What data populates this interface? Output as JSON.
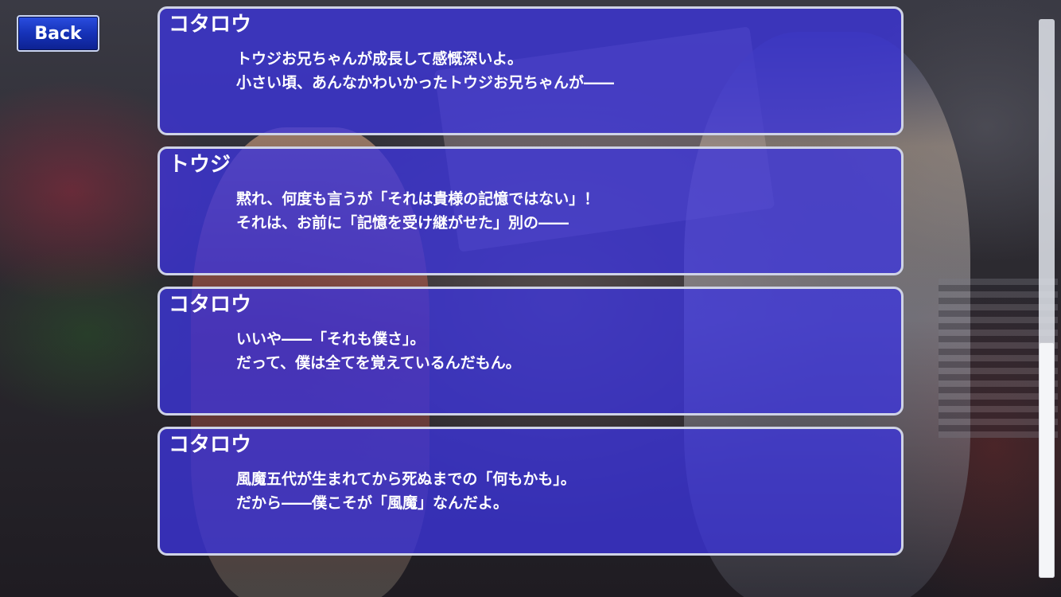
{
  "back_button": {
    "label": "Back"
  },
  "log": [
    {
      "speaker": "コタロウ",
      "lines": [
        "トウジお兄ちゃんが成長して感慨深いよ。",
        "小さい頃、あんなかわいかったトウジお兄ちゃんが――"
      ]
    },
    {
      "speaker": "トウジ",
      "lines": [
        "黙れ、何度も言うが「それは貴様の記憶ではない」！",
        "それは、お前に「記憶を受け継がせた」別の――"
      ]
    },
    {
      "speaker": "コタロウ",
      "lines": [
        "いいや――「それも僕さ」。",
        "だって、僕は全てを覚えているんだもん。"
      ]
    },
    {
      "speaker": "コタロウ",
      "lines": [
        "風魔五代が生まれてから死ぬまでの「何もかも」。",
        "だから――僕こそが「風魔」なんだよ。"
      ]
    }
  ],
  "scrollbar": {
    "position_fraction": 0.58,
    "visible_fraction": 0.42
  },
  "colors": {
    "log_box_fill": "#3c34dc",
    "log_box_border": "#cfd3e6",
    "back_button": "#1632b8",
    "text": "#ffffff"
  }
}
